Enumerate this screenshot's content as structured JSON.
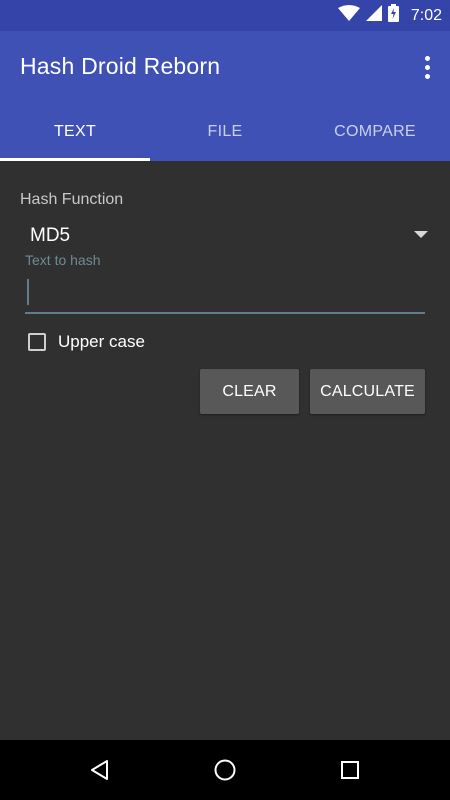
{
  "status_bar": {
    "time": "7:02"
  },
  "app_bar": {
    "title": "Hash Droid Reborn",
    "overflow_icon": "more-vert-icon"
  },
  "tabs": [
    {
      "label": "TEXT",
      "active": true
    },
    {
      "label": "FILE",
      "active": false
    },
    {
      "label": "COMPARE",
      "active": false
    }
  ],
  "form": {
    "hash_function_label": "Hash Function",
    "hash_function_value": "MD5",
    "text_hint": "Text to hash",
    "text_value": "",
    "uppercase_label": "Upper case",
    "uppercase_checked": false
  },
  "buttons": {
    "clear": "CLEAR",
    "calculate": "CALCULATE"
  },
  "colors": {
    "primary": "#3f51b5",
    "primary_dark": "#3444a8",
    "background": "#303030",
    "accent": "#607d8b"
  },
  "nav_bar": {
    "icons": [
      "back-icon",
      "home-icon",
      "recents-icon"
    ]
  }
}
